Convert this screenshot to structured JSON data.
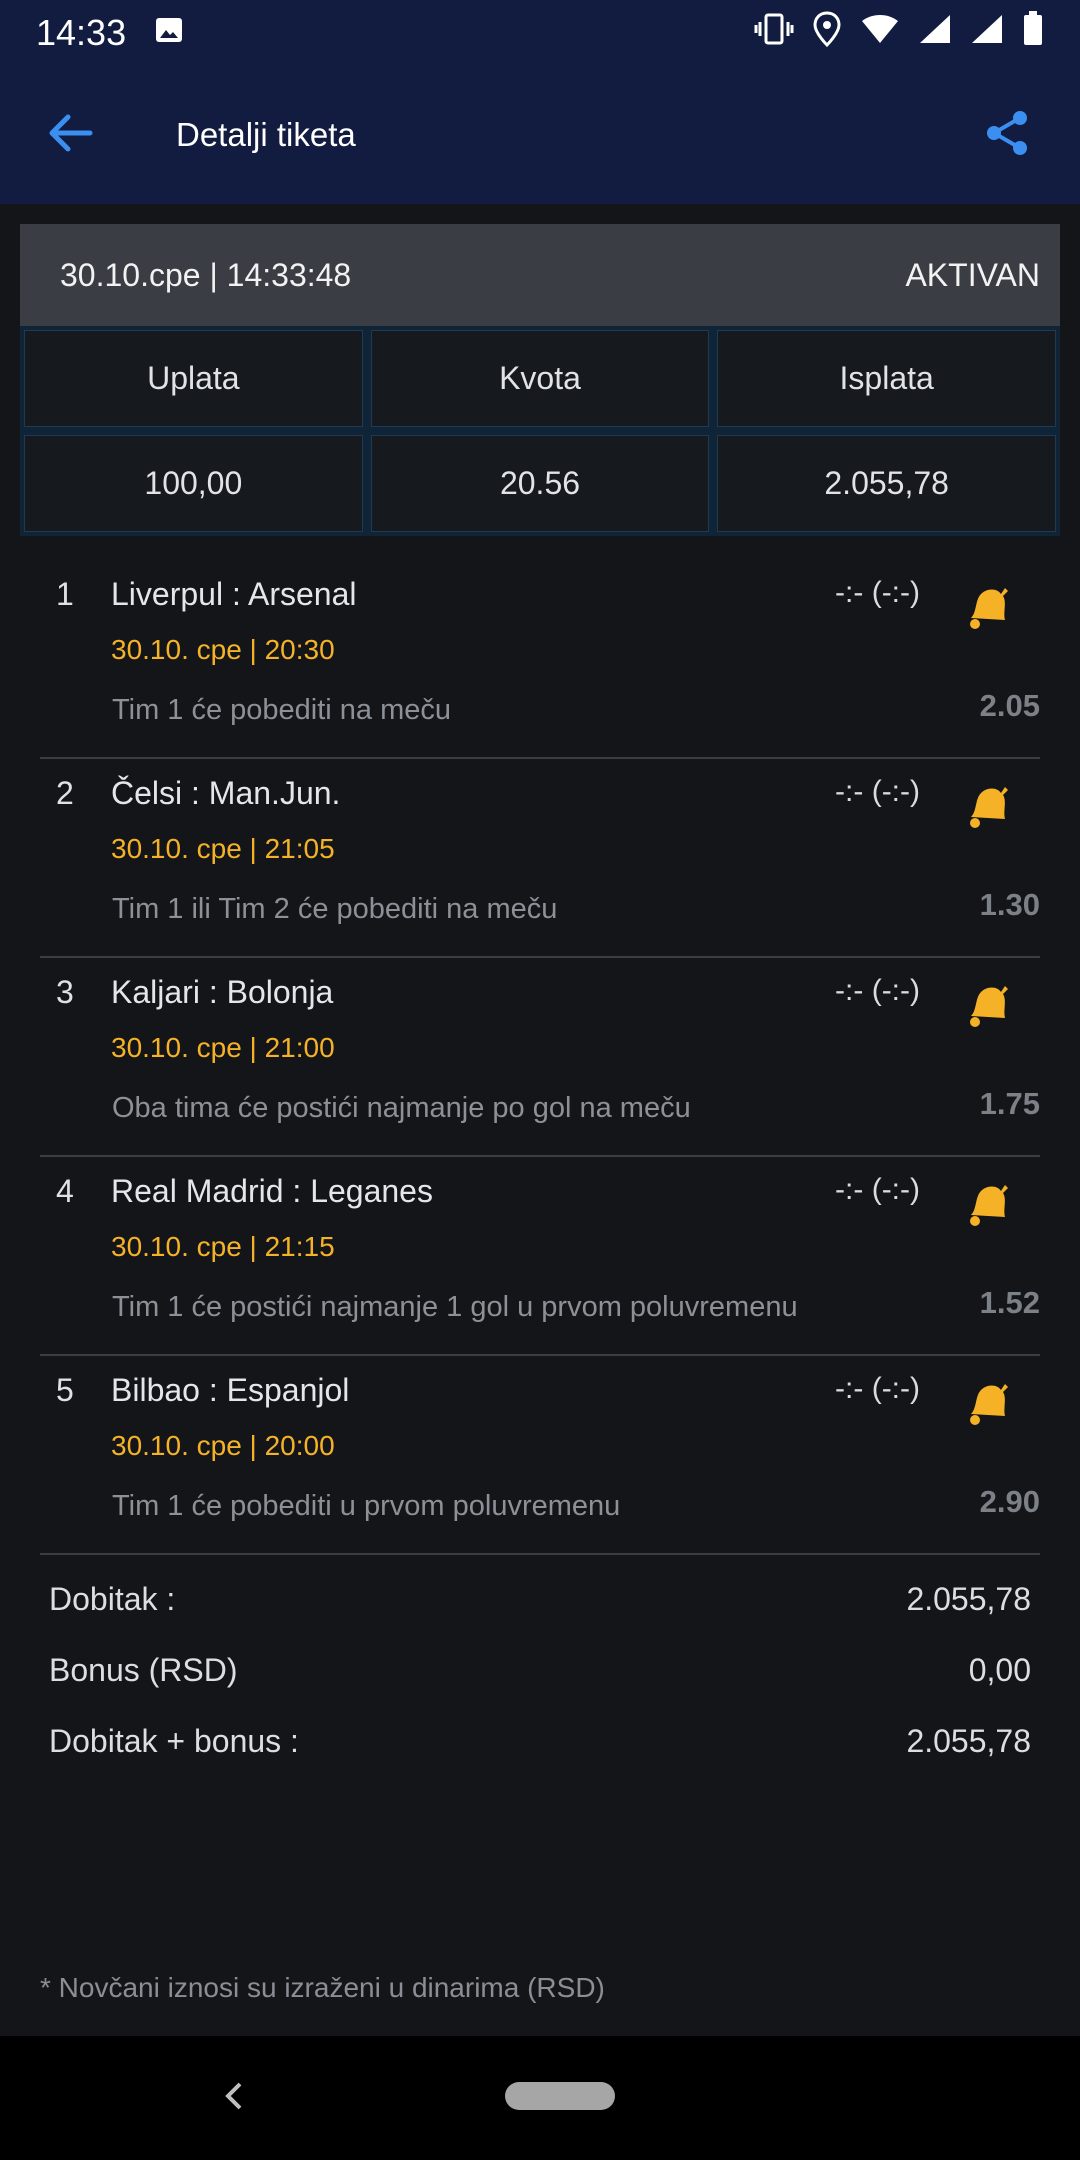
{
  "status_bar": {
    "time": "14:33",
    "icons": [
      "image-icon",
      "vibrate-icon",
      "location-icon",
      "wifi-icon",
      "signal-icon",
      "signal-icon",
      "battery-icon"
    ]
  },
  "app_bar": {
    "title": "Detalji tiketa",
    "back_icon": "arrow-left-icon",
    "share_icon": "share-icon",
    "accent": "#3b8ff0"
  },
  "ticket": {
    "datetime": "30.10.cpe | 14:33:48",
    "status": "AKTIVAN",
    "columns": [
      {
        "label": "Uplata",
        "value": "100,00"
      },
      {
        "label": "Kvota",
        "value": "20.56"
      },
      {
        "label": "Isplata",
        "value": "2.055,78"
      }
    ]
  },
  "matches": [
    {
      "num": "1",
      "teams": "Liverpul : Arsenal",
      "date": "30.10. cpe | 20:30",
      "bet": "Tim 1 će pobediti na meču",
      "score": "-:- (-:-)",
      "odd": "2.05"
    },
    {
      "num": "2",
      "teams": "Čelsi : Man.Jun.",
      "date": "30.10. cpe | 21:05",
      "bet": "Tim 1 ili Tim 2 će pobediti na meču",
      "score": "-:- (-:-)",
      "odd": "1.30"
    },
    {
      "num": "3",
      "teams": "Kaljari : Bolonja",
      "date": "30.10. cpe | 21:00",
      "bet": "Oba tima će postići najmanje po gol na meču",
      "score": "-:- (-:-)",
      "odd": "1.75"
    },
    {
      "num": "4",
      "teams": "Real Madrid : Leganes",
      "date": "30.10. cpe | 21:15",
      "bet": "Tim 1 će postići najmanje 1 gol u prvom poluvremenu",
      "score": "-:- (-:-)",
      "odd": "1.52"
    },
    {
      "num": "5",
      "teams": "Bilbao : Espanjol",
      "date": "30.10. cpe | 20:00",
      "bet": "Tim 1 će pobediti u prvom poluvremenu",
      "score": "-:- (-:-)",
      "odd": "2.90"
    }
  ],
  "summary": {
    "win_label": "Dobitak :",
    "win_value": "2.055,78",
    "bonus_label": "Bonus (RSD)",
    "bonus_value": "0,00",
    "total_label": "Dobitak + bonus :",
    "total_value": "2.055,78"
  },
  "footnote": "* Novčani iznosi su izraženi u dinarima (RSD)",
  "colors": {
    "header_bg": "#111c40",
    "date_accent": "#f5b227",
    "bell": "#f5b227"
  }
}
